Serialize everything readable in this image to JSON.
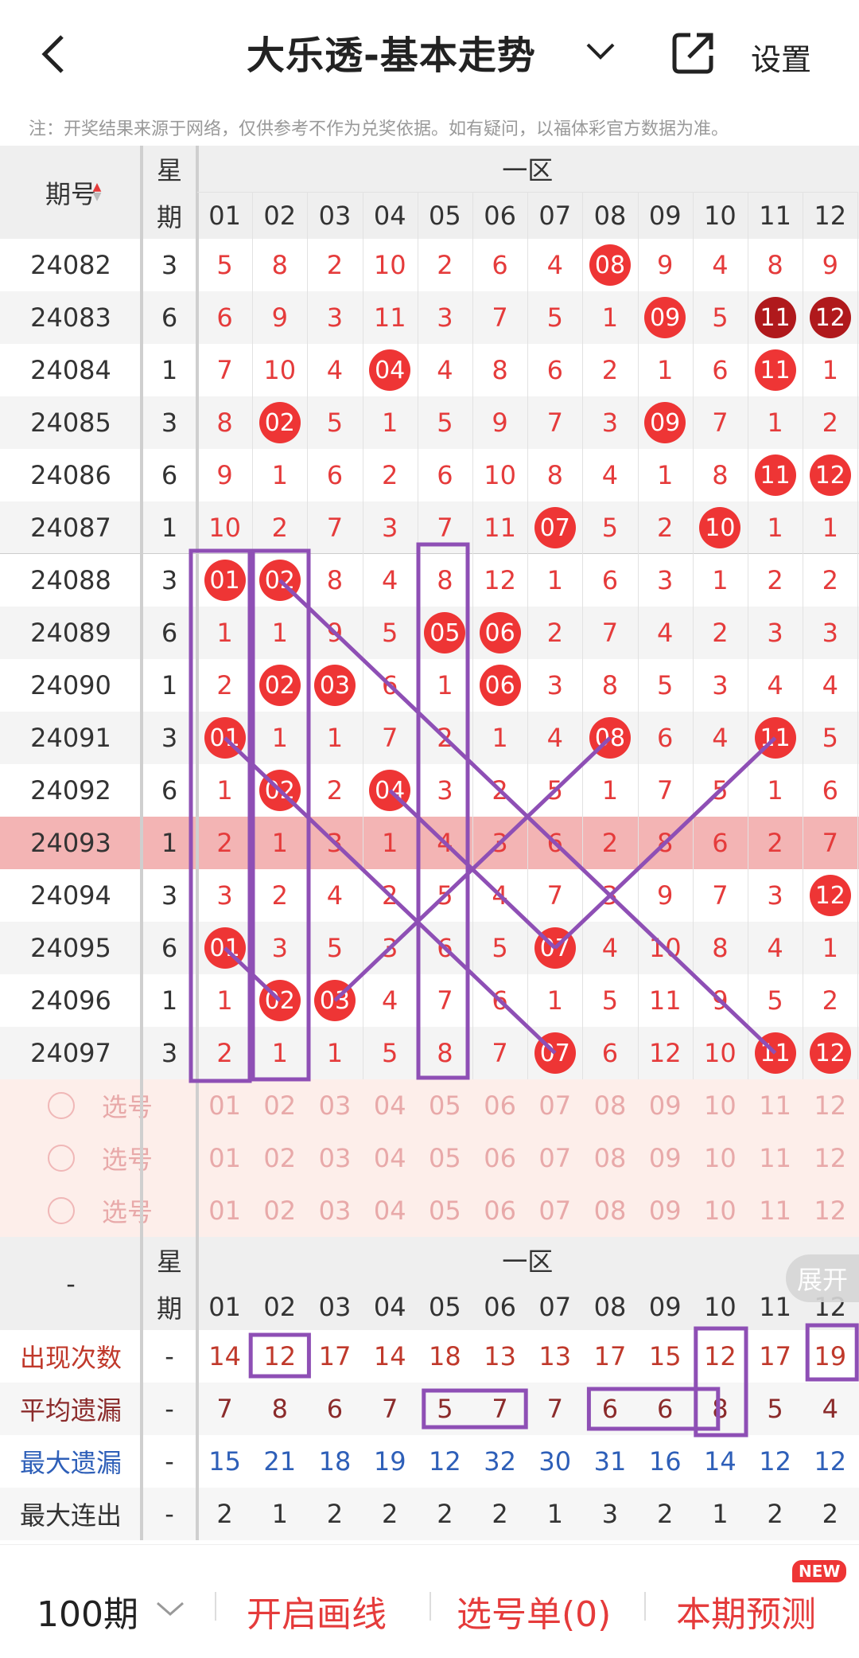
{
  "header": {
    "title": "大乐透-基本走势",
    "settings": "设置",
    "note": "注：开奖结果来源于网络，仅供参考不作为兑奖依据。如有疑问，以福体彩官方数据为准。"
  },
  "table": {
    "col_issue": "期号",
    "col_week_top": "星",
    "col_week_bottom": "期",
    "zone": "一区",
    "columns": [
      "01",
      "02",
      "03",
      "04",
      "05",
      "06",
      "07",
      "08",
      "09",
      "10",
      "11",
      "12"
    ],
    "rows": [
      {
        "issue": "24082",
        "week": "3",
        "cells": [
          "5",
          "8",
          "2",
          "10",
          "2",
          "6",
          "4",
          "08",
          "9",
          "4",
          "8",
          "9"
        ],
        "hits": [
          7
        ]
      },
      {
        "issue": "24083",
        "week": "6",
        "cells": [
          "6",
          "9",
          "3",
          "11",
          "3",
          "7",
          "5",
          "1",
          "09",
          "5",
          "11",
          "12"
        ],
        "hits": [
          8,
          10,
          11
        ]
      },
      {
        "issue": "24084",
        "week": "1",
        "cells": [
          "7",
          "10",
          "4",
          "04",
          "4",
          "8",
          "6",
          "2",
          "1",
          "6",
          "11",
          "1"
        ],
        "hits": [
          3,
          10
        ]
      },
      {
        "issue": "24085",
        "week": "3",
        "cells": [
          "8",
          "02",
          "5",
          "1",
          "5",
          "9",
          "7",
          "3",
          "09",
          "7",
          "1",
          "2"
        ],
        "hits": [
          1,
          8
        ]
      },
      {
        "issue": "24086",
        "week": "6",
        "cells": [
          "9",
          "1",
          "6",
          "2",
          "6",
          "10",
          "8",
          "4",
          "1",
          "8",
          "11",
          "12"
        ],
        "hits": [
          10,
          11
        ]
      },
      {
        "issue": "24087",
        "week": "1",
        "cells": [
          "10",
          "2",
          "7",
          "3",
          "7",
          "11",
          "07",
          "5",
          "2",
          "10",
          "1",
          "1"
        ],
        "hits": [
          6,
          9
        ]
      },
      {
        "issue": "24088",
        "week": "3",
        "cells": [
          "01",
          "02",
          "8",
          "4",
          "8",
          "12",
          "1",
          "6",
          "3",
          "1",
          "2",
          "2"
        ],
        "hits": [
          0,
          1
        ]
      },
      {
        "issue": "24089",
        "week": "6",
        "cells": [
          "1",
          "1",
          "9",
          "5",
          "05",
          "06",
          "2",
          "7",
          "4",
          "2",
          "3",
          "3"
        ],
        "hits": [
          4,
          5
        ]
      },
      {
        "issue": "24090",
        "week": "1",
        "cells": [
          "2",
          "02",
          "03",
          "6",
          "1",
          "06",
          "3",
          "8",
          "5",
          "3",
          "4",
          "4"
        ],
        "hits": [
          1,
          2,
          5
        ]
      },
      {
        "issue": "24091",
        "week": "3",
        "cells": [
          "01",
          "1",
          "1",
          "7",
          "2",
          "1",
          "4",
          "08",
          "6",
          "4",
          "11",
          "5"
        ],
        "hits": [
          0,
          7,
          10
        ]
      },
      {
        "issue": "24092",
        "week": "6",
        "cells": [
          "1",
          "02",
          "2",
          "04",
          "3",
          "2",
          "5",
          "1",
          "7",
          "5",
          "1",
          "6"
        ],
        "hits": [
          1,
          3
        ]
      },
      {
        "issue": "24093",
        "week": "1",
        "cells": [
          "2",
          "1",
          "3",
          "1",
          "4",
          "3",
          "6",
          "2",
          "8",
          "6",
          "2",
          "7"
        ],
        "hits": []
      },
      {
        "issue": "24094",
        "week": "3",
        "cells": [
          "3",
          "2",
          "4",
          "2",
          "5",
          "4",
          "7",
          "3",
          "9",
          "7",
          "3",
          "12"
        ],
        "hits": [
          11
        ]
      },
      {
        "issue": "24095",
        "week": "6",
        "cells": [
          "01",
          "3",
          "5",
          "3",
          "6",
          "5",
          "07",
          "4",
          "10",
          "8",
          "4",
          "1"
        ],
        "hits": [
          0,
          6
        ]
      },
      {
        "issue": "24096",
        "week": "1",
        "cells": [
          "1",
          "02",
          "03",
          "4",
          "7",
          "6",
          "1",
          "5",
          "11",
          "9",
          "5",
          "2"
        ],
        "hits": [
          1,
          2
        ]
      },
      {
        "issue": "24097",
        "week": "3",
        "cells": [
          "2",
          "1",
          "1",
          "5",
          "8",
          "7",
          "07",
          "6",
          "12",
          "10",
          "11",
          "12"
        ],
        "hits": [
          6,
          10,
          11
        ]
      }
    ],
    "pick_label": "选号",
    "stats": [
      {
        "label": "出现次数",
        "dash": "-",
        "values": [
          "14",
          "12",
          "17",
          "14",
          "18",
          "13",
          "13",
          "17",
          "15",
          "12",
          "17",
          "19"
        ],
        "color": "#c0392b"
      },
      {
        "label": "平均遗漏",
        "dash": "-",
        "values": [
          "7",
          "8",
          "6",
          "7",
          "5",
          "7",
          "7",
          "6",
          "6",
          "8",
          "5",
          "4"
        ],
        "color": "#8b2b2b"
      },
      {
        "label": "最大遗漏",
        "dash": "-",
        "values": [
          "15",
          "21",
          "18",
          "19",
          "12",
          "32",
          "30",
          "31",
          "16",
          "14",
          "12",
          "12"
        ],
        "color": "#2e5fb8"
      },
      {
        "label": "最大连出",
        "dash": "-",
        "values": [
          "2",
          "1",
          "2",
          "2",
          "2",
          "2",
          "1",
          "3",
          "2",
          "1",
          "2",
          "2"
        ],
        "color": "#333333"
      }
    ],
    "bottom_header_dash": "-",
    "expand": "展开"
  },
  "footer": {
    "periods": "100期",
    "draw_lines": "开启画线",
    "pick_list": "选号单(0)",
    "predict": "本期预测",
    "new_badge": "NEW"
  },
  "colors": {
    "accent": "#ee3535",
    "line": "#8e4fb5",
    "dark_ball": "#b0191c"
  }
}
